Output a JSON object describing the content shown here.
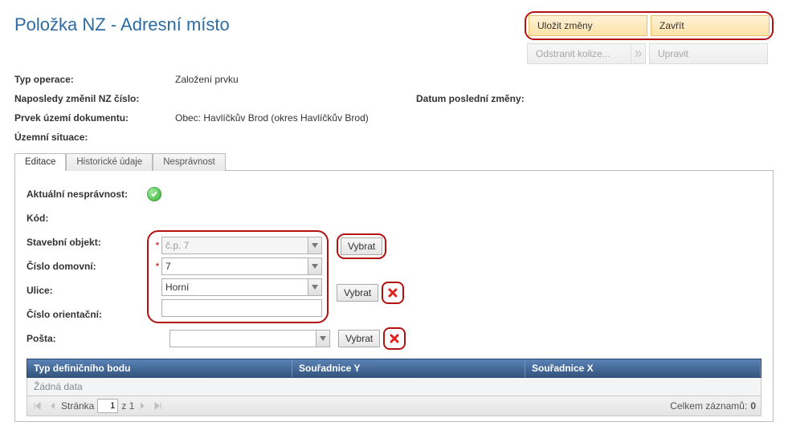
{
  "title": "Položka NZ - Adresní místo",
  "buttons": {
    "save": "Uložit změny",
    "close": "Zavřít",
    "deleteCollision": "Odstranit kolize...",
    "edit": "Upravit"
  },
  "info": {
    "operationTypeLabel": "Typ operace:",
    "operationTypeValue": "Založení prvku",
    "lastChangedByLabel": "Naposledy změnil NZ číslo:",
    "lastChangedByValue": "",
    "lastChangeDateLabel": "Datum poslední změny:",
    "lastChangeDateValue": "",
    "elementLabel": "Prvek území dokumentu:",
    "elementValue": "Obec: Havlíčkův Brod (okres Havlíčkův Brod)",
    "situationLabel": "Územní situace:"
  },
  "tabs": {
    "edit": "Editace",
    "history": "Historické údaje",
    "incorrect": "Nesprávnost"
  },
  "form": {
    "currentIncorrectLabel": "Aktuální nesprávnost:",
    "codeLabel": "Kód:",
    "buildingObjectLabel": "Stavební objekt:",
    "buildingObjectValue": "č.p. 7",
    "houseNumberLabel": "Číslo domovní:",
    "houseNumberValue": "7",
    "streetLabel": "Ulice:",
    "streetValue": "Horní",
    "orientationNumberLabel": "Číslo orientační:",
    "orientationNumberValue": "",
    "postLabel": "Pošta:",
    "postValue": "",
    "selectBtn": "Vybrat"
  },
  "grid": {
    "col1": "Typ definičního bodu",
    "col2": "Souřadnice Y",
    "col3": "Souřadnice X",
    "empty": "Žádná data",
    "pageLabel": "Stránka",
    "pageValue": "1",
    "ofLabel": "z 1",
    "totalLabel": "Celkem záznamů:",
    "totalValue": "0"
  }
}
